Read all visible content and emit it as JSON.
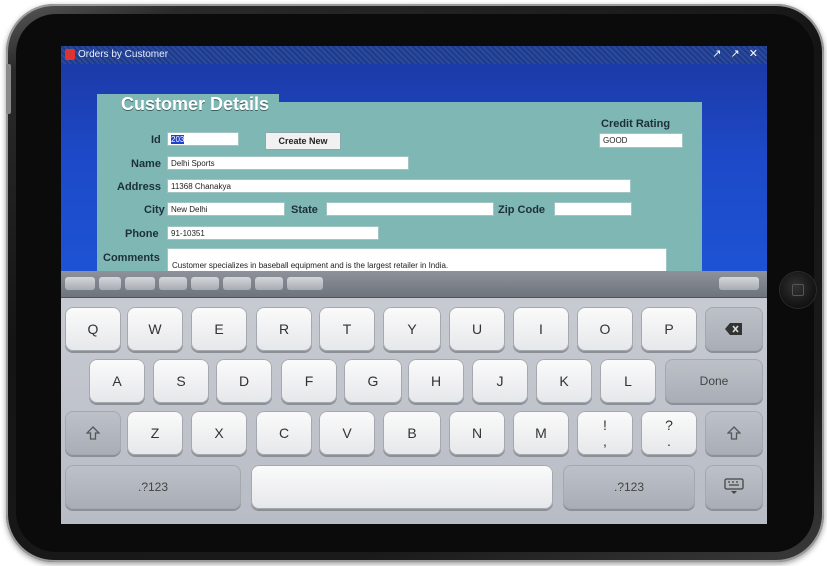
{
  "window": {
    "title": "Orders by Customer",
    "controls": "↗ ↗ ✕"
  },
  "form": {
    "heading": "Customer Details",
    "labels": {
      "id": "Id",
      "name": "Name",
      "address": "Address",
      "city": "City",
      "state": "State",
      "zip": "Zip Code",
      "phone": "Phone",
      "comments": "Comments",
      "credit_rating": "Credit Rating"
    },
    "values": {
      "id": "203",
      "name": "Delhi Sports",
      "address": "11368 Chanakya",
      "city": "New Delhi",
      "state": "",
      "zip": "",
      "phone": "91-10351",
      "credit_rating": "GOOD",
      "comments": "Customer specializes in baseball equipment and is the largest retailer in India."
    },
    "create_new_label": "Create New"
  },
  "keyboard": {
    "row1": [
      "Q",
      "W",
      "E",
      "R",
      "T",
      "Y",
      "U",
      "I",
      "O",
      "P"
    ],
    "row2": [
      "A",
      "S",
      "D",
      "F",
      "G",
      "H",
      "J",
      "K",
      "L"
    ],
    "row3": [
      "Z",
      "X",
      "C",
      "V",
      "B",
      "N",
      "M"
    ],
    "done_label": "Done",
    "numbers_label": ".?123",
    "excl_top": "!",
    "excl_bottom": ",",
    "question_top": "?",
    "question_bottom": "."
  },
  "icons": [
    "app-icon",
    "backspace-icon",
    "shift-icon",
    "keyboard-hide-icon",
    "home-button"
  ]
}
